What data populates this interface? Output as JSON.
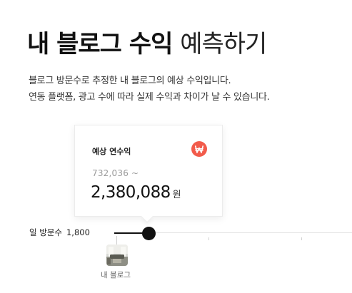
{
  "header": {
    "title_bold": "내 블로그 수익",
    "title_light": "예측하기",
    "description": [
      "블로그 방문수로 추정한 내 블로그의 예상 수익입니다.",
      "연동 플랫폼, 광고 수에 따라 실제 수익과 차이가 날 수 있습니다."
    ]
  },
  "estimate_card": {
    "label": "예상 연수익",
    "badge_icon": "won-icon",
    "min_text": "732,036 ~",
    "max_value": "2,380,088",
    "unit": "원",
    "accent_color": "#f25b4b"
  },
  "slider": {
    "label": "일 방문수",
    "value_text": "1,800",
    "level": 0.15,
    "marker_label": "내 블로그",
    "marker_icon": "blog-thumbnail-image"
  }
}
